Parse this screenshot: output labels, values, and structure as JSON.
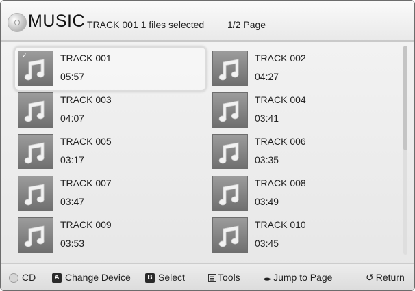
{
  "header": {
    "title": "MUSIC",
    "subtitle": "TRACK 001 1 files selected",
    "page": "1/2 Page"
  },
  "tracks": [
    {
      "name": "TRACK 001",
      "time": "05:57",
      "selected": true
    },
    {
      "name": "TRACK 002",
      "time": "04:27"
    },
    {
      "name": "TRACK 003",
      "time": "04:07"
    },
    {
      "name": "TRACK 004",
      "time": "03:41"
    },
    {
      "name": "TRACK 005",
      "time": "03:17"
    },
    {
      "name": "TRACK 006",
      "time": "03:35"
    },
    {
      "name": "TRACK 007",
      "time": "03:47"
    },
    {
      "name": "TRACK 008",
      "time": "03:49"
    },
    {
      "name": "TRACK 009",
      "time": "03:53"
    },
    {
      "name": "TRACK 010",
      "time": "03:45"
    }
  ],
  "footer": {
    "cd": "CD",
    "a_key": "A",
    "change_device": "Change Device",
    "b_key": "B",
    "select": "Select",
    "tools": "Tools",
    "jump_icon": "◂◂▸▸",
    "jump": "Jump to Page",
    "return_icon": "↺",
    "return": "Return"
  },
  "icons": {
    "header": "disc-icon",
    "track": "music-note-icon",
    "selected_mark": "check-icon",
    "footer_cd": "cd-icon",
    "footer_tools": "tools-icon",
    "footer_return": "return-icon"
  },
  "scroll": {
    "position_fraction": 0.0,
    "visible_fraction": 0.5
  }
}
